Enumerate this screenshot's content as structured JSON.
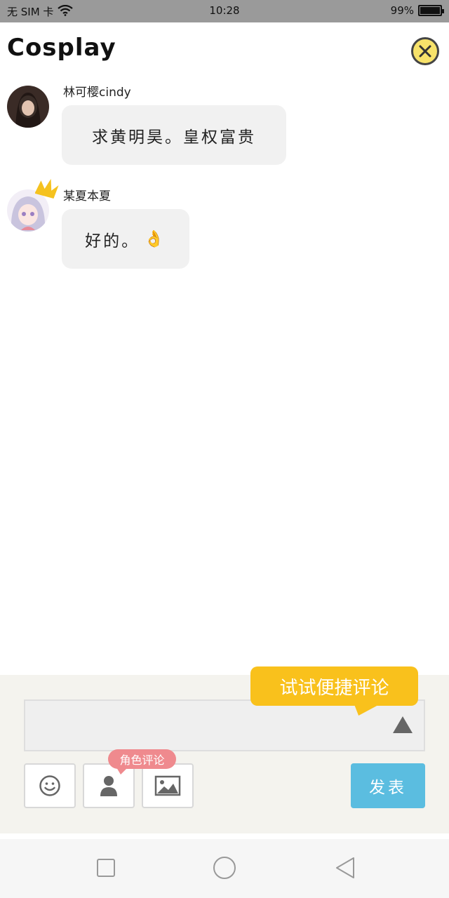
{
  "status": {
    "carrier": "无 SIM 卡",
    "time": "10:28",
    "battery": "99%"
  },
  "header": {
    "title": "Cosplay"
  },
  "messages": [
    {
      "user": "林可樱cindy",
      "text": "求黄明昊。皇权富贵",
      "emoji": ""
    },
    {
      "user": "某夏本夏",
      "text": "好的。",
      "emoji": "👌"
    }
  ],
  "input": {
    "quick_tip": "试试便捷评论",
    "role_tip": "角色评论",
    "send_label": "发表"
  },
  "colors": {
    "accent": "#f9c11c",
    "send": "#5bbde0",
    "role": "#ef8a8e",
    "close": "#f7e26a"
  }
}
